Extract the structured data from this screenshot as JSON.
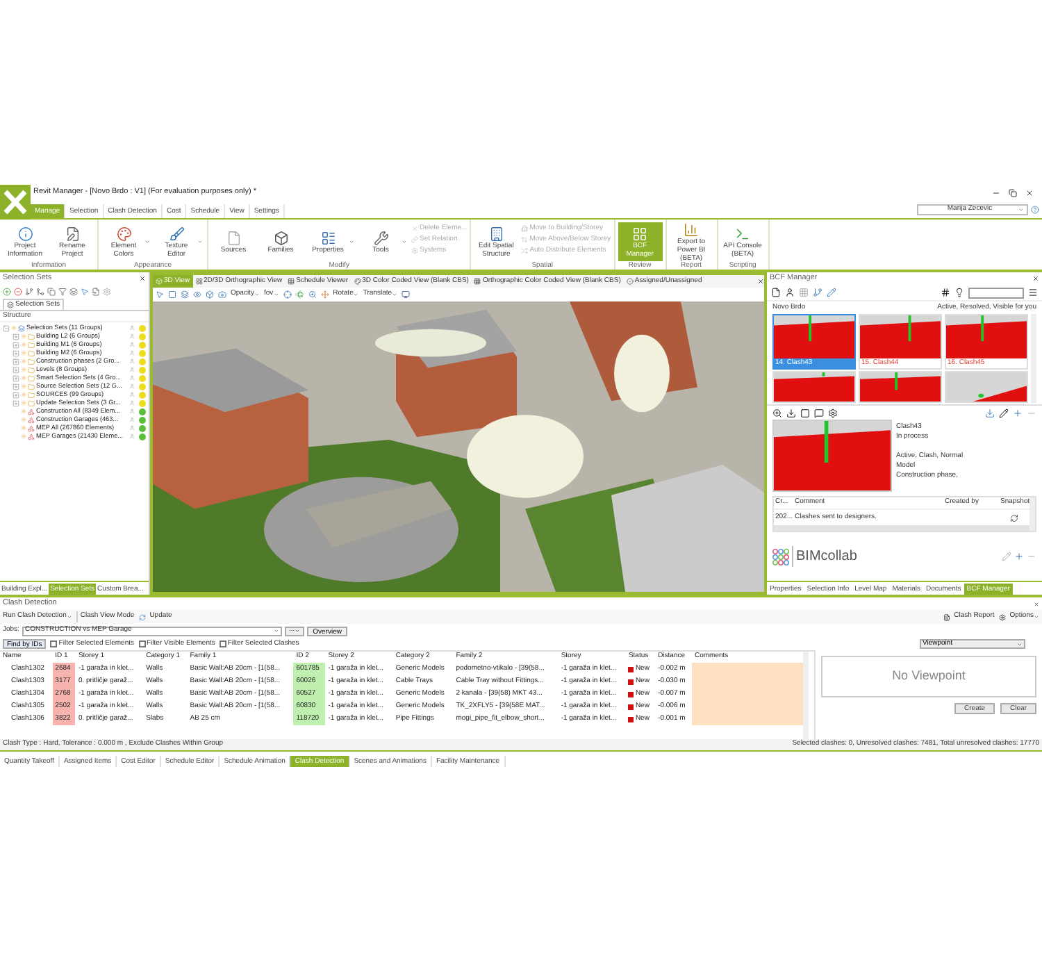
{
  "window": {
    "title": "Revit Manager - [Novo Brdo : V1] (For evaluation purposes only) *",
    "user": "Marija Zecevic"
  },
  "menu_tabs": [
    {
      "label": "Manage",
      "selected": true
    },
    {
      "label": "Selection",
      "selected": false
    },
    {
      "label": "Clash Detection",
      "selected": false
    },
    {
      "label": "Cost",
      "selected": false
    },
    {
      "label": "Schedule",
      "selected": false
    },
    {
      "label": "View",
      "selected": false
    },
    {
      "label": "Settings",
      "selected": false
    }
  ],
  "ribbon": [
    {
      "label": "Information",
      "items": [
        {
          "kind": "large",
          "label": "Project Information",
          "active": false,
          "dropdown": false
        },
        {
          "kind": "large",
          "label": "Rename Project",
          "active": false,
          "dropdown": false
        }
      ]
    },
    {
      "label": "Appearance",
      "items": [
        {
          "kind": "large",
          "label": "Element Colors",
          "active": false,
          "dropdown": true
        },
        {
          "kind": "large",
          "label": "Texture Editor",
          "active": false,
          "dropdown": true
        }
      ]
    },
    {
      "label": "Modify",
      "items": [
        {
          "kind": "large",
          "label": "Sources",
          "active": false,
          "dropdown": false
        },
        {
          "kind": "large",
          "label": "Families",
          "active": false,
          "dropdown": false
        },
        {
          "kind": "large",
          "label": "Properties",
          "active": false,
          "dropdown": true
        },
        {
          "kind": "large",
          "label": "Tools",
          "active": false,
          "dropdown": true
        },
        {
          "kind": "small",
          "label": "Delete Eleme...",
          "disabled": true
        },
        {
          "kind": "small",
          "label": "Set Relation",
          "disabled": true
        },
        {
          "kind": "small",
          "label": "Systems",
          "disabled": true
        }
      ]
    },
    {
      "label": "Spatial",
      "items": [
        {
          "kind": "large",
          "label": "Edit Spatial Structure",
          "active": false,
          "dropdown": false
        },
        {
          "kind": "small",
          "label": "Move to Building/Storey",
          "disabled": true
        },
        {
          "kind": "small",
          "label": "Move Above/Below Storey",
          "disabled": true
        },
        {
          "kind": "small",
          "label": "Auto Distribute Elements",
          "disabled": true
        }
      ]
    },
    {
      "label": "Review",
      "items": [
        {
          "kind": "large",
          "label": "BCF Manager",
          "active": true,
          "dropdown": false
        }
      ]
    },
    {
      "label": "Report",
      "items": [
        {
          "kind": "large",
          "label": "Export to Power BI (BETA)",
          "active": false,
          "dropdown": false
        }
      ]
    },
    {
      "label": "Scripting",
      "items": [
        {
          "kind": "large",
          "label": "API Console (BETA)",
          "active": false,
          "dropdown": false
        }
      ]
    }
  ],
  "selection_panel": {
    "title": "Selection Sets",
    "tab": "Selection Sets",
    "header": "Structure",
    "tree": [
      {
        "label": "Selection Sets (11 Groups)",
        "kind": "root",
        "color": "#f0dc1e",
        "expanded": true,
        "children": [
          {
            "label": "Building L2 (6 Groups)",
            "kind": "group",
            "color": "#f0dc1e",
            "expanded": false
          },
          {
            "label": "Building M1 (6 Groups)",
            "kind": "group",
            "color": "#f0dc1e",
            "expanded": false
          },
          {
            "label": "Building M2 (6 Groups)",
            "kind": "group",
            "color": "#f0dc1e",
            "expanded": false
          },
          {
            "label": "Construction phases (2 Gro...",
            "kind": "group",
            "color": "#f0dc1e",
            "expanded": false
          },
          {
            "label": "Levels (8 Groups)",
            "kind": "group",
            "color": "#f0dc1e",
            "expanded": false
          },
          {
            "label": "Smart Selection Sets (4 Gro...",
            "kind": "group",
            "color": "#f0dc1e",
            "expanded": false
          },
          {
            "label": "Source Selection Sets (12 G...",
            "kind": "group",
            "color": "#f0dc1e",
            "expanded": false
          },
          {
            "label": "SOURCES (99 Groups)",
            "kind": "group",
            "color": "#f0dc1e",
            "expanded": false
          },
          {
            "label": "Update Selection Sets (3 Gr...",
            "kind": "group",
            "color": "#f0dc1e",
            "expanded": false
          },
          {
            "label": "Construction All (8349 Elem...",
            "kind": "set",
            "color": "#5cbf3a"
          },
          {
            "label": "Construction Garages (463...",
            "kind": "set",
            "color": "#5cbf3a"
          },
          {
            "label": "MEP All (267860 Elements)",
            "kind": "set",
            "color": "#5cbf3a"
          },
          {
            "label": "MEP Garages (21430 Eleme...",
            "kind": "set",
            "color": "#5cbf3a"
          }
        ]
      }
    ],
    "bottom_tabs": [
      {
        "label": "Building Expl...",
        "selected": false
      },
      {
        "label": "Selection Sets",
        "selected": true
      },
      {
        "label": "Custom Brea...",
        "selected": false
      }
    ]
  },
  "view": {
    "tabs": [
      {
        "label": "3D View",
        "selected": true
      },
      {
        "label": "2D/3D Orthographic View",
        "selected": false
      },
      {
        "label": "Schedule Viewer",
        "selected": false
      },
      {
        "label": "3D Color Coded View (Blank CBS)",
        "selected": false
      },
      {
        "label": "Orthographic Color Coded View (Blank CBS)",
        "selected": false
      },
      {
        "label": "Assigned/Unassigned",
        "selected": false
      }
    ],
    "toolbar": [
      "Opacity",
      "fov",
      "Rotate",
      "Translate"
    ]
  },
  "bcf": {
    "title": "BCF Manager",
    "project": "Novo Brdo",
    "filter": "Active, Resolved, Visible for you",
    "thumbnails": [
      {
        "caption": "14. Clash43",
        "selected": true
      },
      {
        "caption": "15. Clash44",
        "selected": false
      },
      {
        "caption": "16. Clash45",
        "selected": false
      },
      {
        "selected": false
      },
      {
        "selected": false
      },
      {
        "selected": false
      }
    ],
    "detail": [
      "Clash43",
      "In process",
      "Active, Clash, Normal",
      "Model",
      "Construction phase,"
    ],
    "comment_columns": [
      "Cr...",
      "Comment",
      "Created by",
      "Snapshot"
    ],
    "comments": [
      {
        "date": "202...",
        "text": "Clashes sent to designers."
      }
    ],
    "logo": "BIMcollab",
    "bottom_tabs": [
      {
        "label": "Properties",
        "selected": false
      },
      {
        "label": "Selection Info",
        "selected": false
      },
      {
        "label": "Level Map",
        "selected": false
      },
      {
        "label": "Materials",
        "selected": false
      },
      {
        "label": "Documents",
        "selected": false
      },
      {
        "label": "BCF Manager",
        "selected": true
      }
    ]
  },
  "clash": {
    "title": "Clash Detection",
    "toolbar": [
      "Run Clash Detection",
      "Clash View Mode",
      "Update"
    ],
    "report": "Clash Report",
    "options": "Options",
    "jobs_label": "Jobs:",
    "job": "CONSTRUCTION vs MEP Garage",
    "more": "...",
    "overview": "Overview",
    "find": "Find by IDs",
    "filters": [
      {
        "label": "Filter Selected Elements",
        "checked": false
      },
      {
        "label": "Filter Visible Elements",
        "checked": false
      },
      {
        "label": "Filter Selected Clashes",
        "checked": false
      }
    ],
    "viewpoint": "Viewpoint",
    "columns": [
      "Name",
      "ID 1",
      "Storey 1",
      "Category 1",
      "Family 1",
      "ID 2",
      "Storey 2",
      "Category 2",
      "Family 2",
      "Storey",
      "Status",
      "Distance",
      "Comments"
    ],
    "rows": [
      [
        "Clash1302",
        "2684",
        "-1 garaža in klet...",
        "Walls",
        "Basic Wall:AB 20cm - [1(58...",
        "601785",
        "-1 garaža in klet...",
        "Generic Models",
        "podometno-vtikalo - [39(58...",
        "-1 garaža in klet...",
        "New",
        "-0.002 m"
      ],
      [
        "Clash1303",
        "3177",
        "0. pritličje garaž...",
        "Walls",
        "Basic Wall:AB 20cm - [1(58...",
        "60026",
        "-1 garaža in klet...",
        "Cable Trays",
        "Cable Tray without Fittings...",
        "-1 garaža in klet...",
        "New",
        "-0.030 m"
      ],
      [
        "Clash1304",
        "2768",
        "-1 garaža in klet...",
        "Walls",
        "Basic Wall:AB 20cm - [1(58...",
        "60527",
        "-1 garaža in klet...",
        "Generic Models",
        "2 kanala - [39(58) MKT 43...",
        "-1 garaža in klet...",
        "New",
        "-0.007 m"
      ],
      [
        "Clash1305",
        "2502",
        "-1 garaža in klet...",
        "Walls",
        "Basic Wall:AB 20cm - [1(58...",
        "60830",
        "-1 garaža in klet...",
        "Generic Models",
        "TK_2XFLY5 - [39(58E MAT...",
        "-1 garaža in klet...",
        "New",
        "-0.006 m"
      ],
      [
        "Clash1306",
        "3822",
        "0. pritličje garaž...",
        "Slabs",
        "AB 25 cm",
        "118720",
        "-1 garaža in klet...",
        "Pipe Fittings",
        "mogi_pipe_fit_elbow_short...",
        "-1 garaža in klet...",
        "New",
        "-0.001 m"
      ]
    ],
    "no_viewpoint": "No Viewpoint",
    "buttons": [
      "Create",
      "Clear"
    ],
    "status_left": "Clash Type : Hard, Tolerance : 0.000 m , Exclude Clashes Within Group",
    "status_right": "Selected clashes: 0, Unresolved clashes: 7481, Total unresolved clashes: 17770"
  },
  "bottom_tabs": [
    {
      "label": "Quantity Takeoff",
      "selected": false
    },
    {
      "label": "Assigned Items",
      "selected": false
    },
    {
      "label": "Cost Editor",
      "selected": false
    },
    {
      "label": "Schedule Editor",
      "selected": false
    },
    {
      "label": "Schedule Animation",
      "selected": false
    },
    {
      "label": "Clash Detection",
      "selected": true
    },
    {
      "label": "Scenes and Animations",
      "selected": false
    },
    {
      "label": "Facility Maintenance",
      "selected": false
    }
  ]
}
